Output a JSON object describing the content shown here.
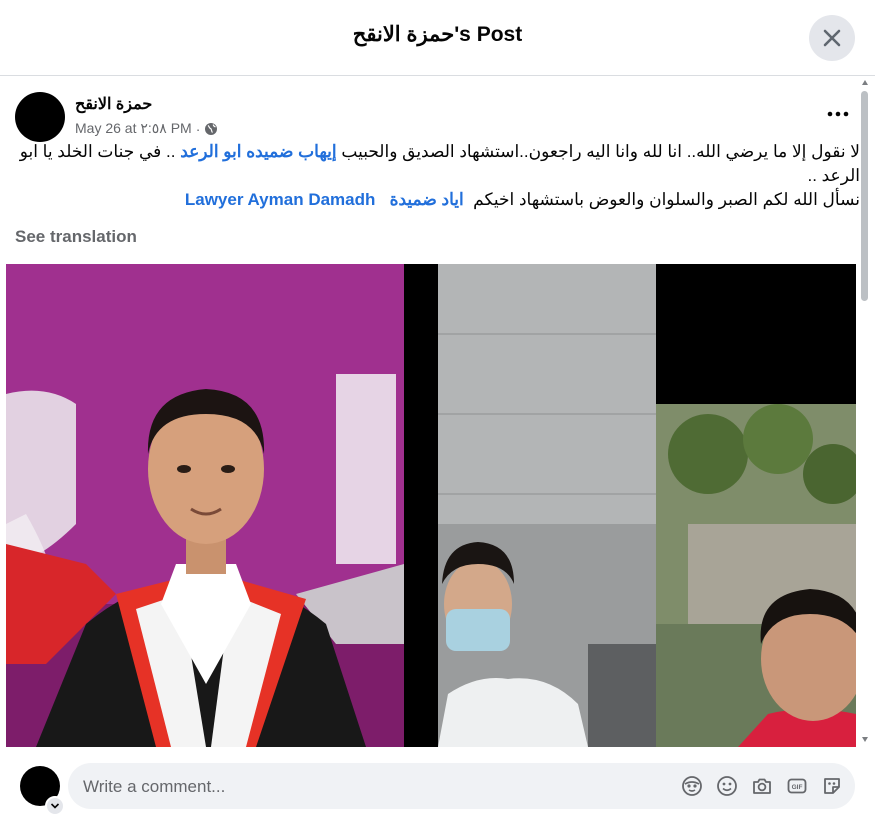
{
  "header": {
    "title": "حمزة الانقح's Post"
  },
  "post": {
    "author": "حمزة الانقح",
    "date": "May 26 at ٢:٥٨ PM",
    "separator": "·",
    "privacy_icon": "globe-icon",
    "line1_text_a": "لا نقول إلا ما يرضي الله.. انا لله وانا اليه راجعون..استشهاد الصديق والحبيب",
    "line1_mention": "إيهاب ضميده ابو الرعد",
    "line1_text_b": ".. في جنات الخلد يا ابو الرعد ..",
    "line2_text": "نسأل الله لكم الصبر والسلوان والعوض باستشهاد اخيكم",
    "line2_mention1": "اياد ضميدة",
    "line2_mention2": "Lawyer Ayman Damadh",
    "see_translation": "See translation",
    "photos": {
      "left_description_icon": "photo-graduate",
      "right_description_icon": "photo-doctor-collage"
    }
  },
  "comment": {
    "placeholder": "Write a comment...",
    "icons": [
      "avatar-sticker-icon",
      "emoji-icon",
      "camera-icon",
      "gif-icon",
      "sticker-icon"
    ]
  },
  "colors": {
    "mention": "#216fdb",
    "secondary_text": "#65676b",
    "input_bg": "#f0f2f5",
    "banner_purple": "#9a2e8c"
  }
}
